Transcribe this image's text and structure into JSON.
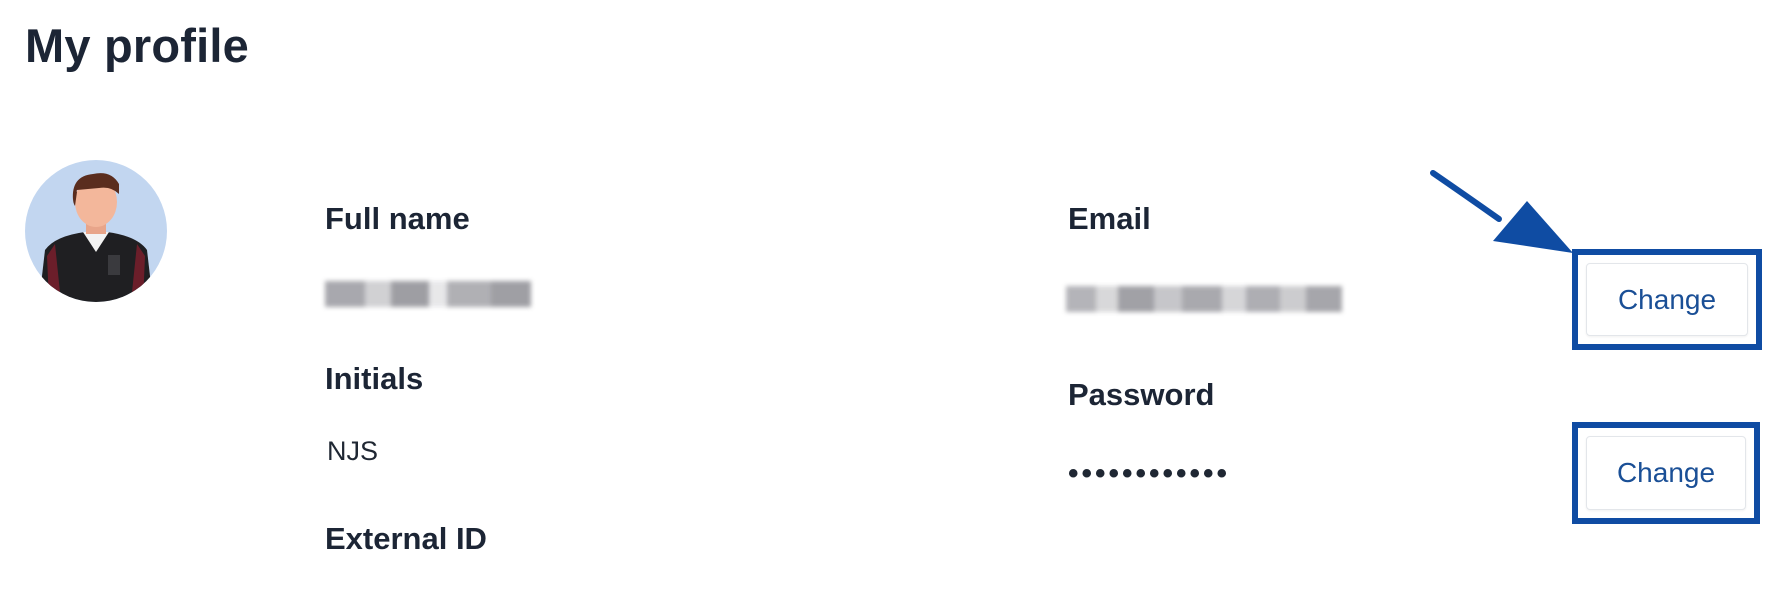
{
  "page": {
    "title": "My profile"
  },
  "profile": {
    "full_name_label": "Full name",
    "initials_label": "Initials",
    "initials_value": "NJS",
    "external_id_label": "External ID",
    "email_label": "Email",
    "password_label": "Password",
    "password_mask": "••••••••••••"
  },
  "actions": {
    "change_email_label": "Change",
    "change_password_label": "Change"
  },
  "colors": {
    "annotation_blue": "#0f4ca3",
    "button_text": "#1a4f96",
    "heading_text": "#1c2535"
  },
  "icons": {
    "annotation": "arrow-pointer-icon",
    "avatar": "user-avatar-illustration"
  }
}
